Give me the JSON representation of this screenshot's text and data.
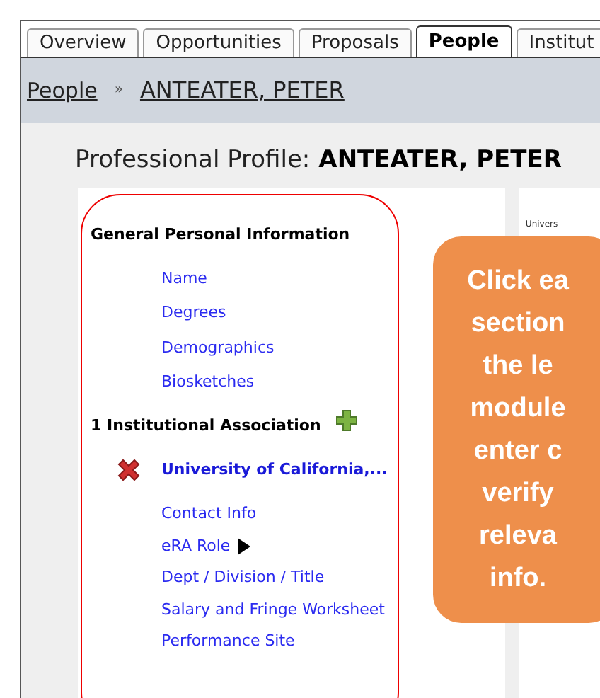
{
  "tabs": [
    {
      "label": "Overview",
      "selected": false
    },
    {
      "label": "Opportunities",
      "selected": false
    },
    {
      "label": "Proposals",
      "selected": false
    },
    {
      "label": "People",
      "selected": true
    },
    {
      "label": "Institut",
      "selected": false
    }
  ],
  "breadcrumb": {
    "items": [
      "People",
      "ANTEATER, PETER"
    ],
    "separator": "»"
  },
  "page_title": {
    "label": "Professional Profile:",
    "name": "ANTEATER, PETER"
  },
  "left_module": {
    "sections": [
      {
        "heading": "General Personal Information",
        "links": [
          {
            "label": "Name"
          },
          {
            "label": "Degrees"
          },
          {
            "label": "Demographics"
          },
          {
            "label": "Biosketches"
          }
        ]
      },
      {
        "heading": "1 Institutional Association",
        "add_icon": true,
        "association": "University of California,...",
        "links": [
          {
            "label": "Contact Info"
          },
          {
            "label": "eRA Role",
            "has_submenu": true
          },
          {
            "label": "Dept / Division / Title"
          },
          {
            "label": "Salary and Fringe Worksheet"
          },
          {
            "label": "Performance Site"
          }
        ]
      }
    ]
  },
  "right_panel": {
    "caption": "Univers"
  },
  "callout": {
    "lines": [
      "Click ea",
      "section",
      "the le",
      "module",
      "enter c",
      "verify",
      "releva",
      "info."
    ]
  }
}
